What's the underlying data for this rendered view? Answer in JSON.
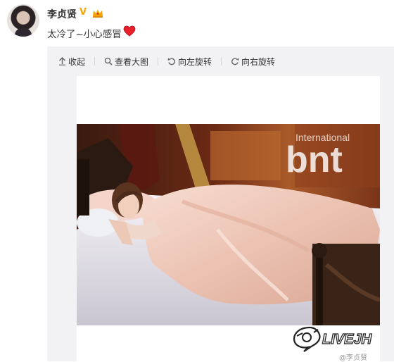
{
  "post": {
    "username": "李贞贤",
    "verified_badge": "V",
    "text": "太冷了~小心感冒",
    "icons": [
      "avatar",
      "vip-crown-icon",
      "heart-icon"
    ]
  },
  "toolbar": {
    "collapse_label": "收起",
    "view_large_label": "查看大图",
    "rotate_left_label": "向左旋转",
    "rotate_right_label": "向右旋转"
  },
  "photo": {
    "watermark_small": "International",
    "watermark_large": "bnt"
  },
  "overlay": {
    "logo_text": "LIVEJH",
    "weibo_handle": "@李贞贤"
  },
  "colors": {
    "text": "#333333",
    "media_bg": "#f2f2f5",
    "verified": "#f5a400",
    "heart": "#e8202a"
  }
}
